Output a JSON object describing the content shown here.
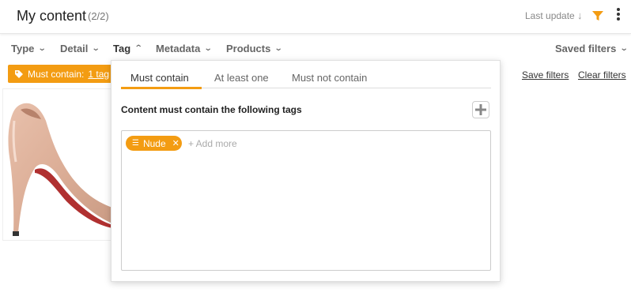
{
  "header": {
    "title": "My content",
    "count": "(2/2)",
    "sort_label": "Last update",
    "sort_direction_icon": "arrow-down-icon",
    "accent_color": "#f39c12"
  },
  "filters": {
    "items": [
      {
        "label": "Type",
        "state": "collapsed"
      },
      {
        "label": "Detail",
        "state": "collapsed"
      },
      {
        "label": "Tag",
        "state": "expanded"
      },
      {
        "label": "Metadata",
        "state": "collapsed"
      },
      {
        "label": "Products",
        "state": "collapsed"
      }
    ],
    "saved_filters_label": "Saved filters"
  },
  "active_filter": {
    "prefix": "Must contain:",
    "count_label": "1 tag",
    "close_glyph": "×"
  },
  "actions": {
    "save_filters": "Save filters",
    "clear_filters": "Clear filters"
  },
  "tag_panel": {
    "tabs": [
      "Must contain",
      "At least one",
      "Must not contain"
    ],
    "active_tab": "Must contain",
    "heading": "Content must contain the following tags",
    "tags": [
      {
        "label": "Nude"
      }
    ],
    "add_more_placeholder": "+ Add more",
    "add_icon": "plus-icon"
  }
}
